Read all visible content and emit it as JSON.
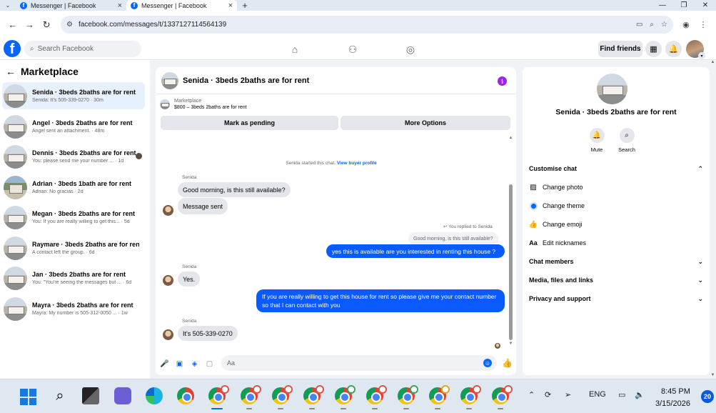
{
  "browser": {
    "tabs": [
      {
        "title": "Messenger | Facebook",
        "active": false
      },
      {
        "title": "Messenger | Facebook",
        "active": true
      }
    ],
    "url": "facebook.com/messages/t/1337127114564139"
  },
  "fb_header": {
    "search_placeholder": "Search Facebook",
    "find_friends": "Find friends"
  },
  "marketplace": {
    "title": "Marketplace",
    "threads": [
      {
        "name": "Senida · 3beds 2baths are for rent",
        "snippet": "Senida: It's 505-339-0270 · 30m",
        "active": true
      },
      {
        "name": "Angel · 3beds 2baths are for rent",
        "snippet": "Angel sent an attachment. · 48m",
        "active": false
      },
      {
        "name": "Dennis · 3beds 2baths are for rent",
        "snippet": "You: please send me your number ... · 1d",
        "active": false
      },
      {
        "name": "Adrian · 3beds 1bath are for rent",
        "snippet": "Adrian: No gracias · 2d",
        "active": false
      },
      {
        "name": "Megan · 3beds 2baths are for rent",
        "snippet": "You: If you are really willing to get this... · 5d",
        "active": false
      },
      {
        "name": "Raymare · 3beds 2baths are for rent",
        "snippet": "A contact left the group. · 6d",
        "active": false
      },
      {
        "name": "Jan · 3beds 2baths are for rent",
        "snippet": "You: \"You're seeing the messages but ... · 6d",
        "active": false
      },
      {
        "name": "Mayra · 3beds 2baths are for rent",
        "snippet": "Mayra: My number is 505-312-0050 ... · 1w",
        "active": false
      }
    ]
  },
  "chat": {
    "title": "Senida · 3beds 2baths are for rent",
    "listing_label": "Marketplace",
    "listing_title": "$800 – 3beds 2baths are for rent",
    "mark_pending": "Mark as pending",
    "more_options": "More Options",
    "started_note": "Senida started this chat.",
    "buyer_profile_link": "View buyer profile",
    "sender_name": "Senida",
    "messages": {
      "m1": "Good morning, is this still available?",
      "m2": "Message sent",
      "reply_note": "You replied to Senida",
      "reply_quote": "Good morning, is this still available?",
      "m3": "yes this is available are you interested in renting this house ?",
      "m4": "Yes.",
      "m5": "If you are really willing to get this house for rent so please give me your contact number so that I  can contact with you",
      "m6": "It's 505-339-0270"
    },
    "composer_placeholder": "Aa"
  },
  "details": {
    "name": "Senida · 3beds 2baths are for rent",
    "mute": "Mute",
    "search": "Search",
    "customise": "Customise chat",
    "change_photo": "Change photo",
    "change_theme": "Change theme",
    "change_emoji": "Change emoji",
    "edit_nicknames": "Edit nicknames",
    "chat_members": "Chat members",
    "media": "Media, files and links",
    "privacy": "Privacy and support"
  },
  "taskbar": {
    "language": "ENG",
    "time": "8:45 PM",
    "date": "3/15/2026",
    "notifications": "20"
  },
  "colors": {
    "brand_blue": "#0866ff",
    "outgoing_bubble": "#0a5bff",
    "incoming_bubble": "#e4e6eb"
  }
}
